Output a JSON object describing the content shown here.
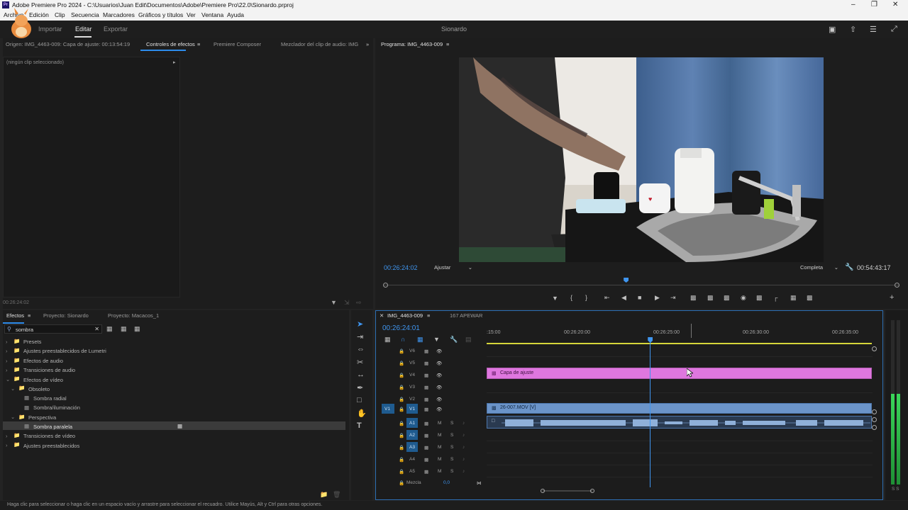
{
  "app": {
    "title": "Adobe Premiere Pro 2024 - C:\\Usuarios\\Juan Edit\\Documentos\\Adobe\\Premiere Pro\\22.0\\Sionardo.prproj",
    "icon": "Pr"
  },
  "menu": [
    "Archivo",
    "Edición",
    "Clip",
    "Secuencia",
    "Marcadores",
    "Gráficos y títulos",
    "Ver",
    "Ventana",
    "Ayuda"
  ],
  "workspace": {
    "tabs": [
      "Importar",
      "Editar",
      "Exportar"
    ],
    "project_name": "Sionardo"
  },
  "source_panel": {
    "tabs": [
      "Origen: IMG_4463-009: Capa de ajuste: 00:13:54:19",
      "Controles de efectos",
      "Premiere Composer",
      "Mezclador del clip de audio: IMG"
    ],
    "no_clip": "(ningún clip seleccionado)",
    "timecode": "00:26:24:02"
  },
  "program_monitor": {
    "title": "Programa: IMG_4463-009",
    "current_tc": "00:26:24:02",
    "fit_label": "Ajustar",
    "quality_label": "Completa",
    "duration_tc": "00:54:43:17",
    "playhead_fraction": 0.47
  },
  "effects_panel": {
    "tabs": [
      "Efectos",
      "Proyecto: Sionardo",
      "Proyecto: Macacos_1"
    ],
    "search_value": "sombra",
    "tree": [
      {
        "label": "Presets",
        "level": 0
      },
      {
        "label": "Ajustes preestablecidos de Lumetri",
        "level": 0
      },
      {
        "label": "Efectos de audio",
        "level": 0
      },
      {
        "label": "Transiciones de audio",
        "level": 0
      },
      {
        "label": "Efectos de vídeo",
        "level": 0,
        "open": true
      },
      {
        "label": "Obsoleto",
        "level": 1,
        "open": true
      },
      {
        "label": "Sombra radial",
        "level": 2
      },
      {
        "label": "Sombra/iluminación",
        "level": 2
      },
      {
        "label": "Perspectiva",
        "level": 1,
        "open": true
      },
      {
        "label": "Sombra paralela",
        "level": 2,
        "selected": true
      },
      {
        "label": "Transiciones de vídeo",
        "level": 0
      },
      {
        "label": "Ajustes preestablecidos",
        "level": 0
      }
    ]
  },
  "timeline": {
    "tabs": [
      "IMG_4463-009",
      "167 APEWAR"
    ],
    "timecode": "00:26:24:01",
    "ruler": [
      ":15:00",
      "00:26:20:00",
      "00:26:25:00",
      "00:26:30:00",
      "00:26:35:00"
    ],
    "video_tracks": [
      "V6",
      "V5",
      "V4",
      "V3",
      "V2",
      "V1"
    ],
    "audio_tracks": [
      "A1",
      "A2",
      "A3",
      "A4",
      "A5"
    ],
    "source_v": "V1",
    "source_a": "A1",
    "track_letters": {
      "mute": "M",
      "solo": "S"
    },
    "adjustment_clip": "Capa de ajuste",
    "video_clip": "26-007.MOV [V]",
    "mix_label": "Mezcla",
    "mix_value": "0,0",
    "playhead_fraction": 0.424
  },
  "meters": {
    "labels": "S S",
    "level": 0.55
  },
  "status_bar": "Haga clic para seleccionar o haga clic en un espacio vacío y arrastre para seleccionar el recuadro. Utilice Mayús, Alt y Ctrl para otras opciones.",
  "colors": {
    "accent": "#2d8ceb",
    "adjustment": "#df77df",
    "video_clip": "#6b94c9",
    "audio_clip": "#5e7fa8"
  }
}
